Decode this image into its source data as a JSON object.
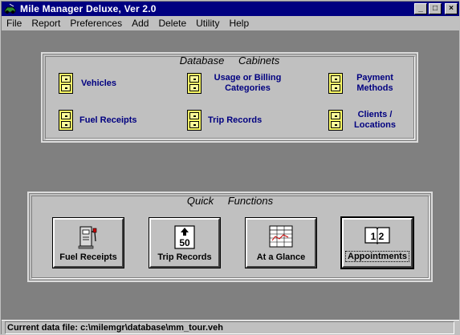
{
  "window": {
    "title": "Mile Manager Deluxe, Ver 2.0",
    "controls": {
      "minimize": "_",
      "maximize": "□",
      "close": "×"
    }
  },
  "menu": [
    {
      "label": "File"
    },
    {
      "label": "Report"
    },
    {
      "label": "Preferences"
    },
    {
      "label": "Add"
    },
    {
      "label": "Delete"
    },
    {
      "label": "Utility"
    },
    {
      "label": "Help"
    }
  ],
  "database": {
    "title": "Database Cabinets",
    "cabinets": [
      {
        "label": "Vehicles",
        "icon": "file-cabinet-icon"
      },
      {
        "label": "Usage or Billing Categories",
        "icon": "file-cabinet-icon"
      },
      {
        "label": "Payment Methods",
        "icon": "file-cabinet-icon"
      },
      {
        "label": "Fuel Receipts",
        "icon": "file-cabinet-icon"
      },
      {
        "label": "Trip Records",
        "icon": "file-cabinet-icon"
      },
      {
        "label": "Clients / Locations",
        "icon": "file-cabinet-icon"
      }
    ]
  },
  "quick": {
    "title": "Quick Functions",
    "buttons": [
      {
        "label": "Fuel Receipts",
        "icon": "fuel-pump-icon"
      },
      {
        "label": "Trip Records",
        "icon": "odometer-50-icon",
        "icon_text": "50"
      },
      {
        "label": "At a Glance",
        "icon": "spreadsheet-icon"
      },
      {
        "label": "Appointments",
        "icon": "calendar-book-icon",
        "icon_text": "1 2"
      }
    ]
  },
  "status": {
    "text": "Current data file: c:\\milemgr\\database\\mm_tour.veh"
  }
}
